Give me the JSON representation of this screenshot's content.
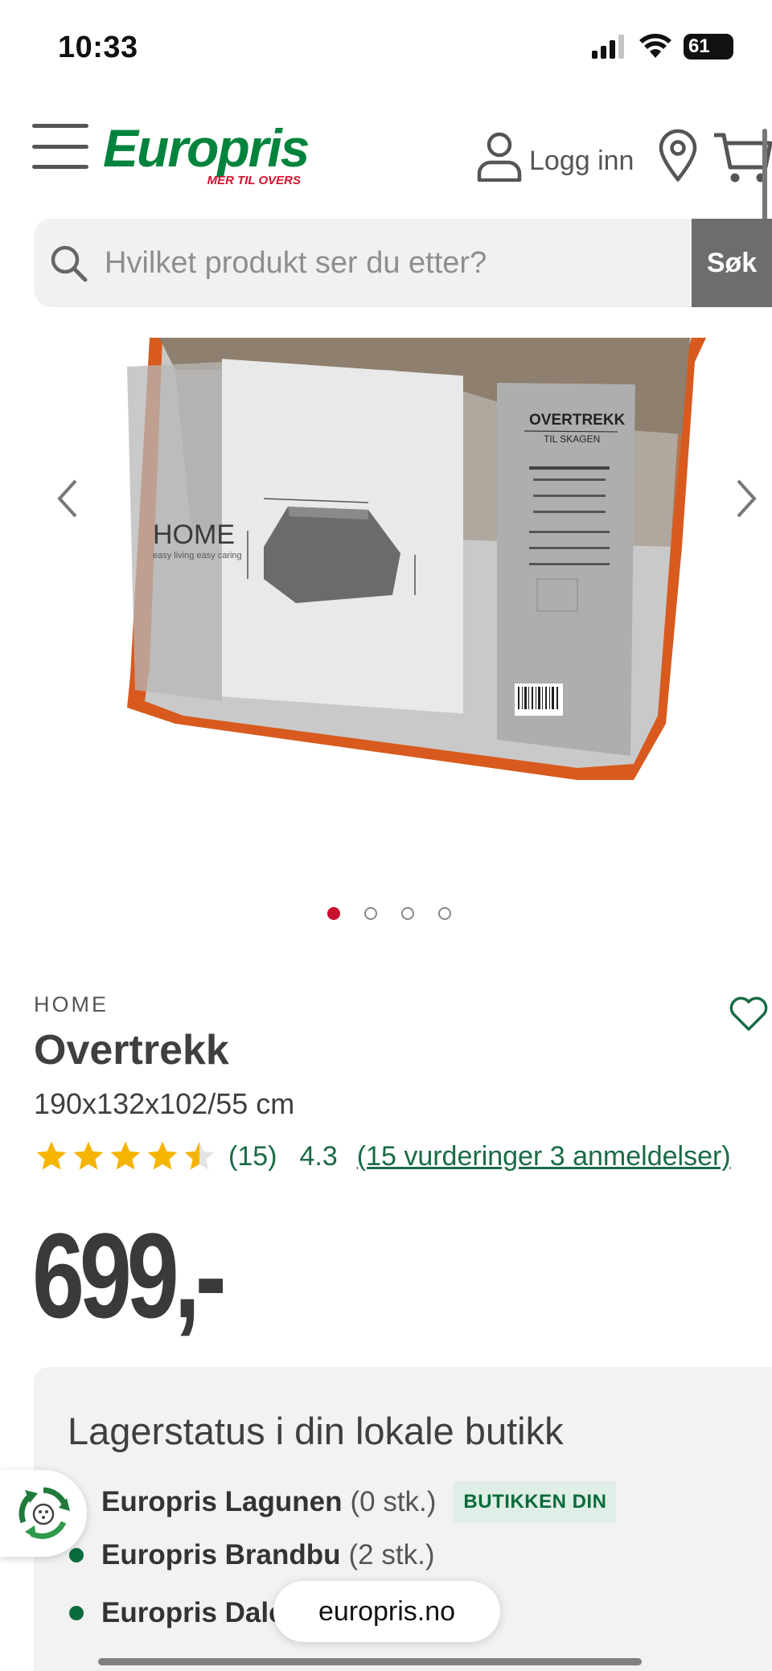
{
  "status_bar": {
    "time": "10:33",
    "battery": "61"
  },
  "header": {
    "logo_text": "Europris",
    "logo_tagline": "MER TIL OVERS",
    "login_label": "Logg inn"
  },
  "search": {
    "placeholder": "Hvilket produkt ser du etter?",
    "button_label": "Søk"
  },
  "gallery": {
    "image_count": 4,
    "active_index": 0,
    "package_brand": "HOME",
    "package_brand_tagline": "easy living easy caring",
    "package_title": "OVERTREKK",
    "package_subtitle": "TIL SKAGEN"
  },
  "product": {
    "brand": "HOME",
    "title": "Overtrekk",
    "dimensions": "190x132x102/55 cm",
    "rating_stars": 4.3,
    "rating_count_label": "(15)",
    "rating_score": "4.3",
    "reviews_link": "(15 vurderinger 3 anmeldelser)",
    "price": "699,-"
  },
  "stock": {
    "title": "Lagerstatus i din lokale butikk",
    "stores": [
      {
        "name": "Europris Lagunen",
        "qty": "(0 stk.)",
        "badge": "BUTIKKEN DIN"
      },
      {
        "name": "Europris Brandbu",
        "qty": "(2 stk.)"
      },
      {
        "name": "Europris Dale",
        "qty": ""
      }
    ]
  },
  "browser": {
    "url": "europris.no"
  },
  "colors": {
    "brand_green": "#00843d",
    "brand_red": "#d2122e",
    "link_green": "#1a6b45",
    "star_yellow": "#f5b400"
  }
}
